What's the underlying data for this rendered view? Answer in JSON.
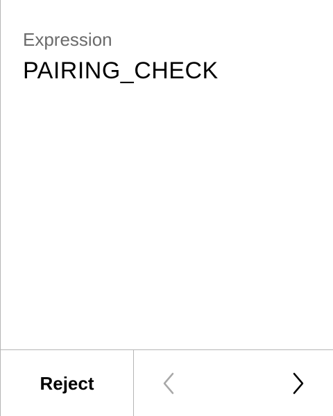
{
  "field": {
    "label": "Expression",
    "value": "PAIRING_CHECK"
  },
  "footer": {
    "reject_label": "Reject",
    "prev_icon": "chevron-left-icon",
    "next_icon": "chevron-right-icon",
    "prev_enabled": false,
    "next_enabled": true
  },
  "colors": {
    "label": "#6b6b6b",
    "text": "#000000",
    "divider": "#b5b5b5",
    "disabled_icon": "#a8a8a8"
  }
}
